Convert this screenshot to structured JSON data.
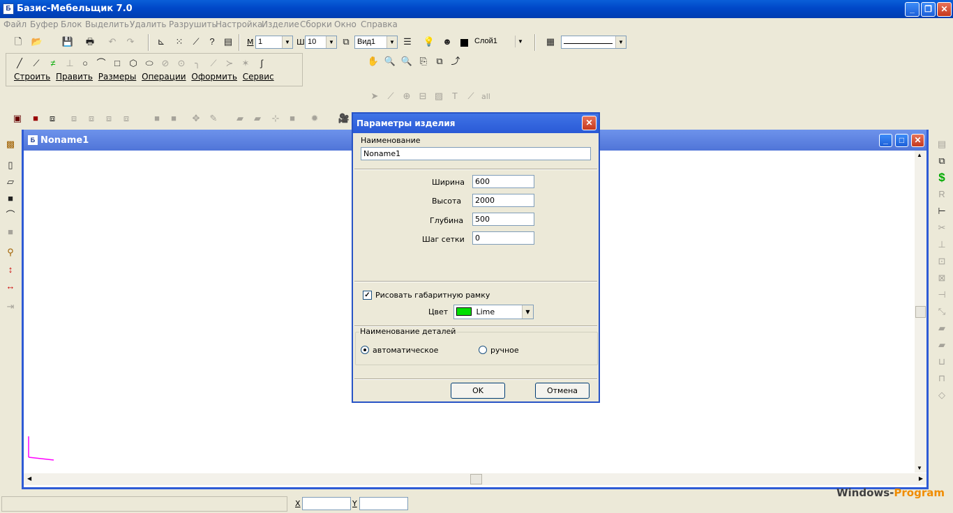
{
  "app": {
    "title": "Базис-Мебельщик 7.0"
  },
  "menu": [
    "Файл",
    "Буфер",
    "Блок",
    "Выделить",
    "Удалить",
    "Разрушить",
    "Настройка",
    "Изделие",
    "Сборки",
    "Окно",
    "Справка"
  ],
  "toolbar": {
    "scale_label": "М",
    "scale_value": "1",
    "step_label": "Ш",
    "step_value": "10",
    "view_value": "Вид1",
    "layer_value": "Слой1"
  },
  "draw_tabs": [
    "Строить",
    "Править",
    "Размеры",
    "Операции",
    "Оформить",
    "Сервис"
  ],
  "snap_label": "all",
  "document": {
    "title": "Noname1"
  },
  "dialog": {
    "title": "Параметры изделия",
    "name_label": "Наименование",
    "name_value": "Noname1",
    "width_label": "Ширина",
    "width_value": "600",
    "height_label": "Высота",
    "height_value": "2000",
    "depth_label": "Глубина",
    "depth_value": "500",
    "grid_label": "Шаг сетки",
    "grid_value": "0",
    "frame_checkbox_label": "Рисовать габаритную рамку",
    "color_label": "Цвет",
    "color_value": "Lime",
    "color_swatch": "#00e000",
    "parts_group_label": "Наименование деталей",
    "auto_label": "автоматическое",
    "manual_label": "ручное",
    "ok_label": "OK",
    "cancel_label": "Отмена"
  },
  "status": {
    "x_label": "X",
    "y_label": "Y"
  },
  "watermark": {
    "part1": "Windows-",
    "part2": "Program"
  }
}
